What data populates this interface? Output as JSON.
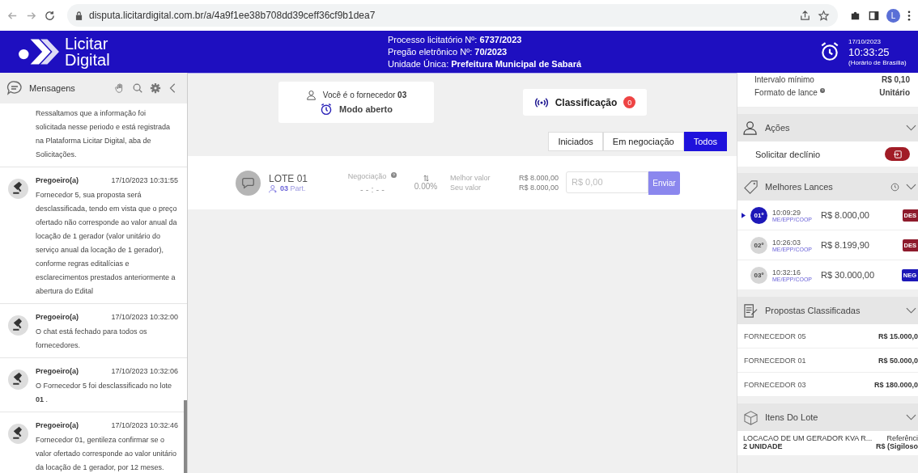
{
  "browser": {
    "url": "disputa.licitardigital.com.br/a/4a9f1ee38b708dd39ceff36cf9b1dea7",
    "avatar": "L"
  },
  "header": {
    "logo_line1": "Licitar",
    "logo_line2": "Digital",
    "lines": [
      {
        "label": "Processo licitatório Nº:",
        "value": "6737/2023"
      },
      {
        "label": "Pregão eletrônico Nº:",
        "value": "70/2023"
      },
      {
        "label": "Unidade Única:",
        "value": "Prefeitura Municipal de Sabará"
      }
    ],
    "date": "17/10/2023",
    "time": "10:33:25",
    "timezone": "(Horário de Brasília)"
  },
  "messages_panel": {
    "title": "Mensagens",
    "messages": [
      {
        "text": "Ressaltamos que a informação foi solicitada nesse periodo e está registrada na Plataforma Licitar Digital, aba de Solicitações."
      },
      {
        "author": "Pregoeiro(a)",
        "time": "17/10/2023 10:31:55",
        "text": "Fornecedor 5, sua proposta será desclassificada, tendo em vista que o preço ofertado não corresponde ao valor anual da locação de 1 gerador (valor unitário do serviço anual da locação de 1 gerador), conforme regras editalícias e esclarecimentos prestados anteriormente a abertura do Edital"
      },
      {
        "author": "Pregoeiro(a)",
        "time": "17/10/2023 10:32:00",
        "text": "O chat está fechado para todos os fornecedores."
      },
      {
        "author": "Pregoeiro(a)",
        "time": "17/10/2023 10:32:06",
        "text": "O Fornecedor 5 foi desclassificado no lote **01** ."
      },
      {
        "author": "Pregoeiro(a)",
        "time": "17/10/2023 10:32:46",
        "text": "Fornecedor 01, gentileza confirmar se o valor ofertado corresponde ao valor unitário da locação de 1 gerador, por 12 meses."
      }
    ]
  },
  "center": {
    "supplier_label": "Você é o fornecedor **03**",
    "mode": "Modo aberto",
    "classification": {
      "label": "Classificação",
      "count": "0"
    },
    "tabs": [
      {
        "label": "Iniciados",
        "selected": false
      },
      {
        "label": "Em negociação",
        "selected": false
      },
      {
        "label": "Todos",
        "selected": true
      }
    ],
    "lote": {
      "name": "LOTE 01",
      "participants": "03",
      "participants_suffix": "Part.",
      "negotiation_label": "Negociação",
      "timer": "- - : - -",
      "percent": "0.00%",
      "best_label": "Melhor valor",
      "best_value": "R$ 8.000,00",
      "own_label": "Seu valor",
      "own_value": "R$ 8.000,00",
      "bid_placeholder": "R$ 0,00",
      "send": "Enviar"
    }
  },
  "right": {
    "info": [
      {
        "label": "Intervalo mínimo",
        "value": "R$ 0,10",
        "help": false
      },
      {
        "label": "Formato de lance",
        "value": "Unitário",
        "help": true
      }
    ],
    "actions": {
      "title": "Ações",
      "items": [
        {
          "label": "Solicitar declínio"
        }
      ]
    },
    "best_bids": {
      "title": "Melhores Lances",
      "bids": [
        {
          "rank": "01º",
          "time": "10:09:29",
          "category": "ME/EPP/COOP",
          "value": "R$ 8.000,00",
          "status": "DES",
          "color": "#8e1b2c",
          "selected": true
        },
        {
          "rank": "02º",
          "time": "10:26:03",
          "category": "ME/EPP/COOP",
          "value": "R$ 8.199,90",
          "status": "DES",
          "color": "#8e1b2c",
          "selected": false
        },
        {
          "rank": "03º",
          "time": "10:32:16",
          "category": "ME/EPP/COOP",
          "value": "R$ 30.000,00",
          "status": "NEG",
          "color": "#1d18b8",
          "selected": false
        }
      ]
    },
    "proposals": {
      "title": "Propostas Classificadas",
      "rows": [
        {
          "supplier": "FORNECEDOR 05",
          "value": "R$ 15.000,0"
        },
        {
          "supplier": "FORNECEDOR 01",
          "value": "R$ 50.000,0"
        },
        {
          "supplier": "FORNECEDOR 03",
          "value": "R$ 180.000,0"
        }
      ]
    },
    "lot_items": {
      "title": "Itens Do Lote",
      "description": "LOCACAO DE UM GERADOR KVA R...",
      "reference": "Referênci",
      "quantity": "2 UNIDADE",
      "price": "R$ (Sigiloso"
    }
  }
}
